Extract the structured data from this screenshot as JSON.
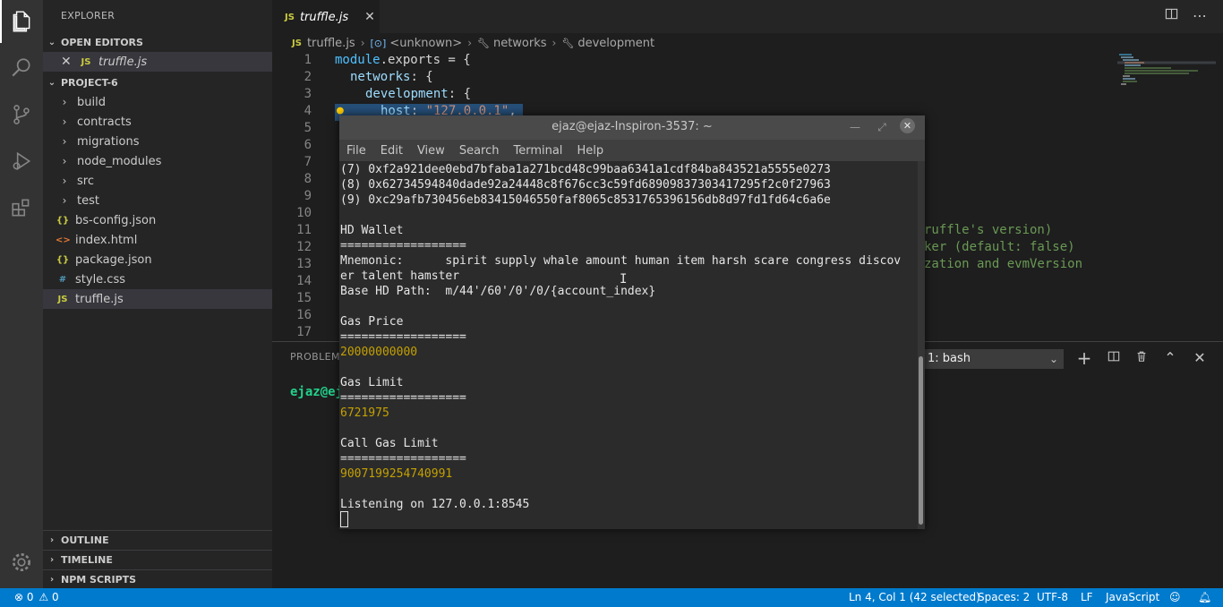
{
  "explorer": {
    "title": "EXPLORER",
    "open_editors_label": "OPEN EDITORS",
    "open_editor_file": "truffle.js",
    "project_label": "PROJECT-6",
    "items": [
      {
        "label": "build",
        "type": "folder"
      },
      {
        "label": "contracts",
        "type": "folder"
      },
      {
        "label": "migrations",
        "type": "folder"
      },
      {
        "label": "node_modules",
        "type": "folder"
      },
      {
        "label": "src",
        "type": "folder"
      },
      {
        "label": "test",
        "type": "folder"
      },
      {
        "label": "bs-config.json",
        "type": "json",
        "icon_text": "{}"
      },
      {
        "label": "index.html",
        "type": "html",
        "icon_text": "<>"
      },
      {
        "label": "package.json",
        "type": "json",
        "icon_text": "{}"
      },
      {
        "label": "style.css",
        "type": "css",
        "icon_text": "#"
      },
      {
        "label": "truffle.js",
        "type": "js",
        "icon_text": "JS"
      }
    ],
    "outline_label": "OUTLINE",
    "timeline_label": "TIMELINE",
    "npm_label": "NPM SCRIPTS"
  },
  "editor": {
    "tab_label": "truffle.js",
    "tab_icon_text": "JS",
    "breadcrumb": [
      "truffle.js",
      "<unknown>",
      "networks",
      "development"
    ],
    "line_numbers": [
      "1",
      "2",
      "3",
      "4",
      "5",
      "6",
      "7",
      "8",
      "9",
      "10",
      "11",
      "12",
      "13",
      "14",
      "15",
      "16",
      "17"
    ],
    "code": {
      "l1_a": "module",
      "l1_b": ".exports = {",
      "l2_a": "networks",
      "l2_b": ": {",
      "l3_a": "development",
      "l3_b": ": {",
      "l4_a": "host",
      "l4_b": ": ",
      "l4_c": "\"127.0.0.1\"",
      "l4_d": ",",
      "l11_tail": "ruffle's version)",
      "l12_tail": "ker (default: false)",
      "l13_tail": "zation and evmVersion"
    }
  },
  "panel": {
    "problems_label": "PROBLEMS",
    "terminal_select": "1: bash",
    "prompt_text": "ejaz@ej"
  },
  "status": {
    "errors": "0",
    "warnings": "0",
    "position": "Ln 4, Col 1 (42 selected)",
    "spaces": "Spaces: 2",
    "encoding": "UTF-8",
    "eol": "LF",
    "language": "JavaScript"
  },
  "terminal_window": {
    "title": "ejaz@ejaz-Inspiron-3537: ~",
    "menu": [
      "File",
      "Edit",
      "View",
      "Search",
      "Terminal",
      "Help"
    ],
    "lines": [
      "(7) 0xf2a921dee0ebd7bfaba1a271bcd48c99baa6341a1cdf84ba843521a5555e0273",
      "(8) 0x62734594840dade92a24448c8f676cc3c59fd68909837303417295f2c0f27963",
      "(9) 0xc29afb730456eb83415046550faf8065c8531765396156db8d97fd1fd64c6a6e",
      "",
      "HD Wallet",
      "==================",
      "Mnemonic:      spirit supply whale amount human item harsh scare congress discov",
      "er talent hamster",
      "Base HD Path:  m/44'/60'/0'/0/{account_index}",
      "",
      "Gas Price",
      "==================",
      "20000000000",
      "",
      "Gas Limit",
      "==================",
      "6721975",
      "",
      "Call Gas Limit",
      "==================",
      "9007199254740991",
      "",
      "Listening on 127.0.0.1:8545"
    ]
  },
  "colors": {
    "accent": "#007acc",
    "sidebar": "#252526",
    "editor_bg": "#1e1e1e",
    "terminal_yellow": "#c4a000"
  }
}
